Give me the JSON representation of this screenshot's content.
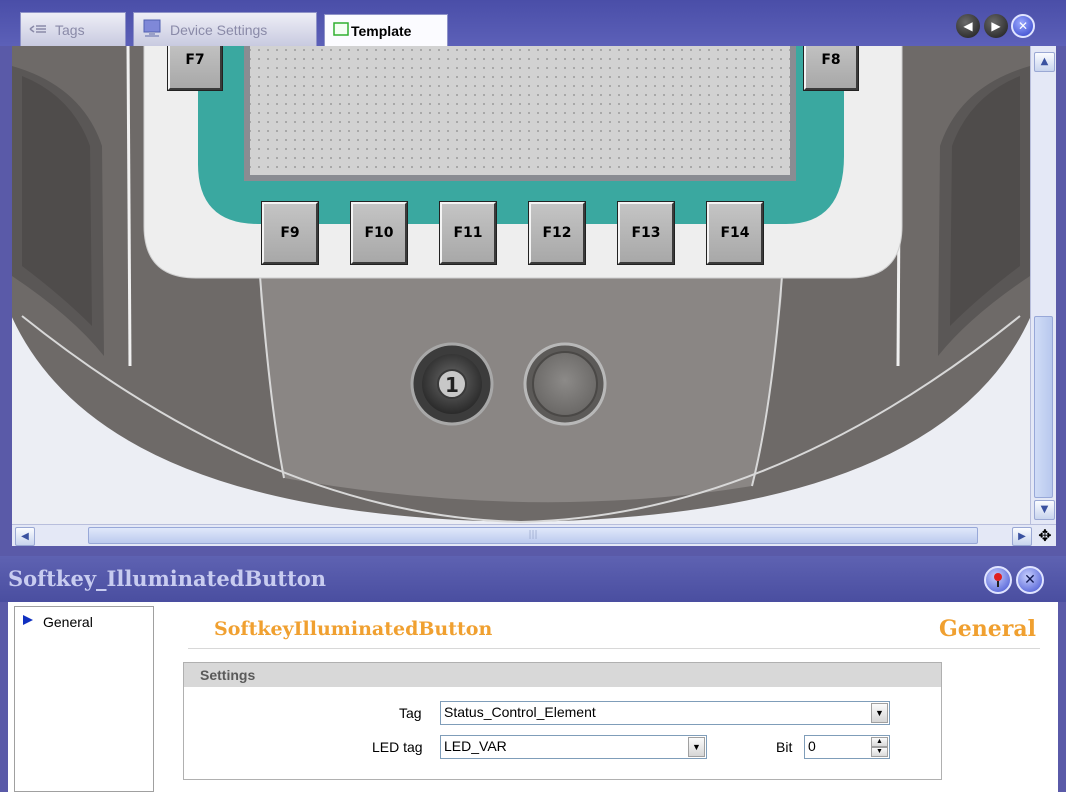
{
  "tabs": [
    {
      "label": "Tags",
      "icon": "tags-list-icon",
      "active": false
    },
    {
      "label": "Device Settings",
      "icon": "device-monitor-icon",
      "active": false
    },
    {
      "label": "Template",
      "icon": "template-icon",
      "active": true
    }
  ],
  "nav_buttons": [
    "previous-arrow-icon",
    "next-arrow-icon",
    "close-icon"
  ],
  "device": {
    "function_keys_top": [
      "F7",
      "F8"
    ],
    "function_keys_bottom": [
      "F9",
      "F10",
      "F11",
      "F12",
      "F13",
      "F14"
    ],
    "illuminated_button_symbol": "1"
  },
  "properties": {
    "title": "Softkey_IlluminatedButton",
    "title_buttons": [
      "pin-icon",
      "close-icon"
    ],
    "nav_items": [
      {
        "label": "General",
        "icon": "arrow-right-icon"
      }
    ],
    "object_name": "SoftkeyIlluminatedButton",
    "section_name": "General",
    "settings": {
      "header": "Settings",
      "tag_label": "Tag",
      "tag_value": "Status_Control_Element",
      "led_tag_label": "LED tag",
      "led_tag_value": "LED_VAR",
      "bit_label": "Bit",
      "bit_value": "0"
    }
  },
  "colors": {
    "frame": "#5a5aa8",
    "bezel_dark": "#6e6a68",
    "teal": "#3aa8a0",
    "orange_heading": "#f0a030"
  }
}
